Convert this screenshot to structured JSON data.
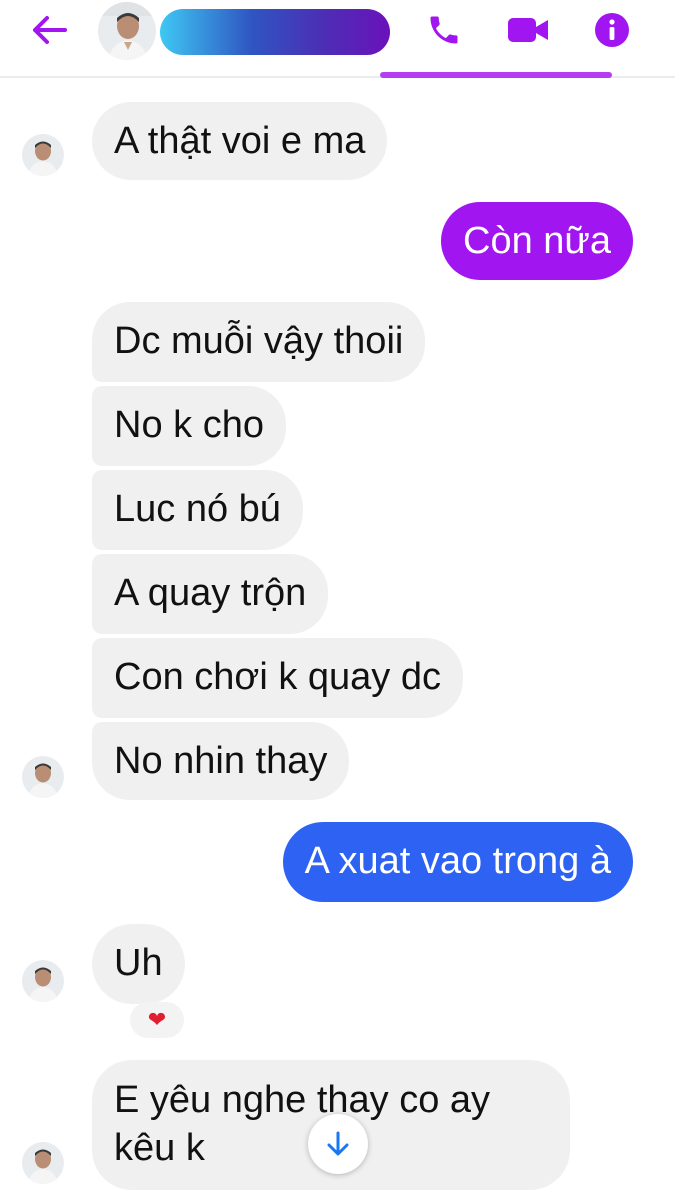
{
  "header": {
    "contact_name_redacted": true,
    "accent_color": "#a015f0"
  },
  "messages": [
    {
      "sender": "contact",
      "text": "A thật voi e ma"
    },
    {
      "sender": "me",
      "text": "Còn nữa",
      "color": "#a015f0"
    },
    {
      "sender": "contact",
      "text": "Dc muỗi vậy thoii"
    },
    {
      "sender": "contact",
      "text": "No k cho"
    },
    {
      "sender": "contact",
      "text": "Luc nó bú"
    },
    {
      "sender": "contact",
      "text": "A quay trộn"
    },
    {
      "sender": "contact",
      "text": "Con chơi k quay dc"
    },
    {
      "sender": "contact",
      "text": "No nhin thay"
    },
    {
      "sender": "me",
      "text": "A xuat vao trong à",
      "color": "#2d62f3"
    },
    {
      "sender": "contact",
      "text": "Uh",
      "reaction": "heart"
    },
    {
      "sender": "contact",
      "text_line1": "E yêu nghe thay co ay",
      "text_line2": "kêu k"
    }
  ],
  "icons": [
    "back-arrow-icon",
    "phone-icon",
    "video-camera-icon",
    "info-icon",
    "heart-icon",
    "arrow-down-icon"
  ]
}
